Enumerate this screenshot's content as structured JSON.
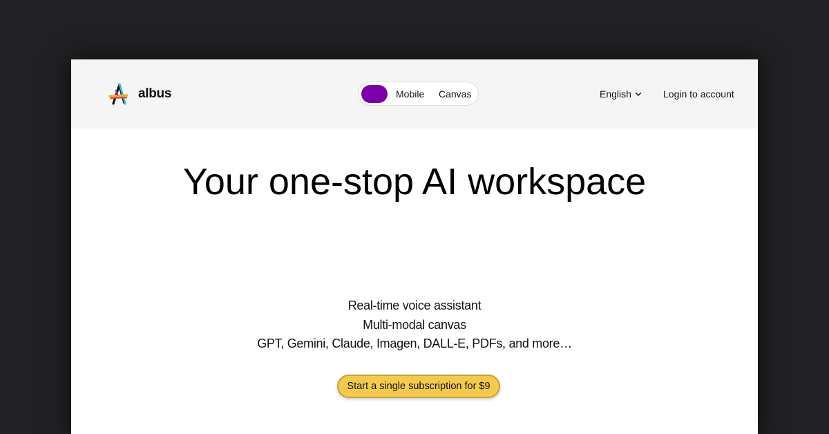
{
  "brand": {
    "name": "albus",
    "logo_icon": "albus-a-logo",
    "logo_colors": [
      "#f2a93b",
      "#e0463c",
      "#3cc6c0",
      "#7b3fa8",
      "#111111"
    ]
  },
  "header": {
    "mode_toggle": {
      "active_color": "#7a00a8",
      "options": [
        "Mobile",
        "Canvas"
      ]
    },
    "language": {
      "label": "English",
      "icon": "chevron-down-icon"
    },
    "login_label": "Login to account"
  },
  "hero": {
    "title": "Your one-stop AI workspace",
    "features": [
      "Real-time voice assistant",
      "Multi-modal canvas",
      "GPT, Gemini, Claude, Imagen, DALL-E, PDFs, and more…"
    ],
    "cta_label": "Start a single subscription for $9",
    "cta_color": "#f3c94f"
  },
  "colors": {
    "backdrop": "#212124",
    "header_bg": "#f5f5f5",
    "page_bg": "#ffffff"
  }
}
